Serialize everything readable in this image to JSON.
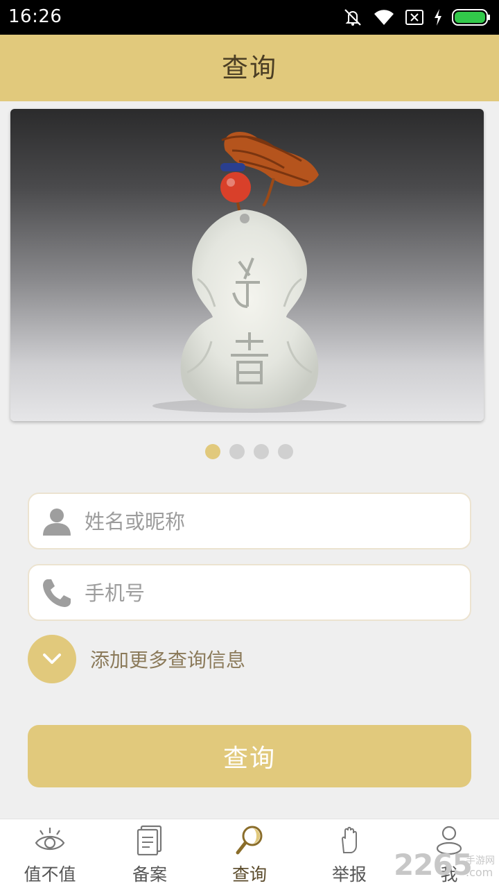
{
  "status_bar": {
    "time": "16:26",
    "icons": [
      "mute-icon",
      "wifi-icon",
      "no-sim-icon",
      "charging-icon",
      "battery-icon"
    ],
    "battery_color": "#32c94a"
  },
  "header": {
    "title": "查询"
  },
  "banner": {
    "image": "jade-gourd-pendant",
    "page_count": 4,
    "active_index": 0
  },
  "form": {
    "name_placeholder": "姓名或昵称",
    "phone_placeholder": "手机号",
    "more_label": "添加更多查询信息",
    "query_button": "查询"
  },
  "tabs": [
    {
      "label": "值不值",
      "icon": "eye-icon"
    },
    {
      "label": "备案",
      "icon": "document-icon"
    },
    {
      "label": "查询",
      "icon": "magnifier-icon",
      "active": true
    },
    {
      "label": "举报",
      "icon": "hand-icon"
    },
    {
      "label": "我",
      "icon": "profile-icon"
    }
  ],
  "watermark": {
    "number": "2265",
    "cn": "手游网",
    "domain": ".com"
  },
  "colors": {
    "accent": "#e1c97c",
    "background": "#efefef",
    "status_bar": "#000000"
  }
}
